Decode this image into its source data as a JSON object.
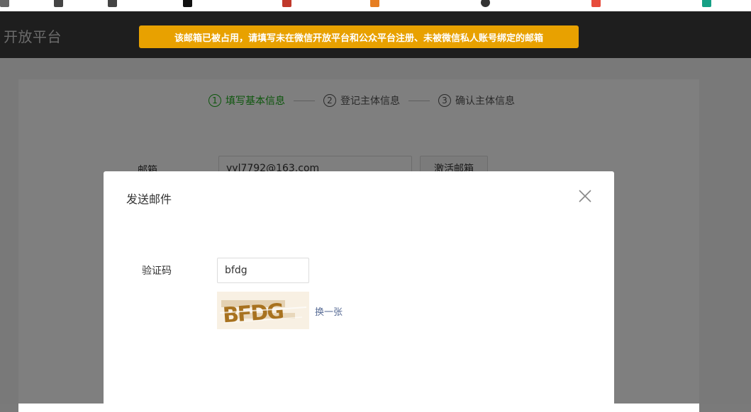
{
  "header": {
    "logo_text": "开放平台",
    "alert": "该邮箱已被占用，请填写未在微信开放平台和公众平台注册、未被微信私人账号绑定的邮箱"
  },
  "steps": [
    {
      "num": "1",
      "label": "填写基本信息",
      "state": "active"
    },
    {
      "num": "2",
      "label": "登记主体信息",
      "state": "inactive"
    },
    {
      "num": "3",
      "label": "确认主体信息",
      "state": "inactive"
    }
  ],
  "form": {
    "email_label": "邮箱",
    "email_value": "yyl7792@163.com",
    "activate_label": "激活邮箱"
  },
  "modal": {
    "title": "发送邮件",
    "captcha_label": "验证码",
    "captcha_value": "bfdg",
    "captcha_image_text": "BFDG",
    "refresh_label": "换一张"
  },
  "colors": {
    "alert_bg": "#e8a100",
    "header_bg": "#1e1e1e",
    "step_active": "#1aad19",
    "link": "#576b95",
    "captcha_ink": "#a8721f"
  }
}
